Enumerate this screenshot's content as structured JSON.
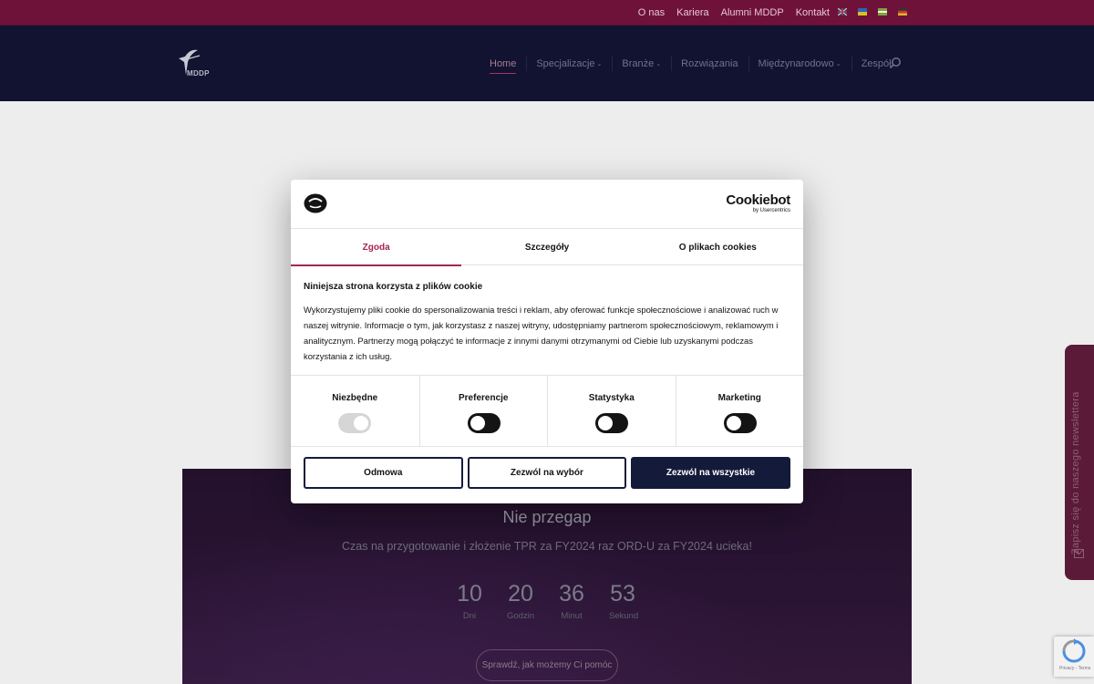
{
  "topbar": {
    "links": [
      "O nas",
      "Kariera",
      "Alumni MDDP",
      "Kontakt"
    ]
  },
  "logo": {
    "text": "MDDP"
  },
  "nav": {
    "items": [
      {
        "label": "Home",
        "active": true,
        "dropdown": false
      },
      {
        "label": "Specjalizacje",
        "active": false,
        "dropdown": true
      },
      {
        "label": "Branże",
        "active": false,
        "dropdown": true
      },
      {
        "label": "Rozwiązania",
        "active": false,
        "dropdown": false
      },
      {
        "label": "Międzynarodowo",
        "active": false,
        "dropdown": true
      },
      {
        "label": "Zespół",
        "active": false,
        "dropdown": false
      }
    ],
    "search_icon": "search-icon"
  },
  "hero": {
    "title": "Nie przegap",
    "subtitle": "Czas na przygotowanie i złożenie TPR za FY2024 raz ORD-U za FY2024 ucieka!",
    "countdown": [
      {
        "value": "10",
        "label": "Dni"
      },
      {
        "value": "20",
        "label": "Godzin"
      },
      {
        "value": "36",
        "label": "Minut"
      },
      {
        "value": "53",
        "label": "Sekund"
      }
    ],
    "cta": "Sprawdź, jak możemy Ci pomóc"
  },
  "newsletter": {
    "label": "Zapisz się do naszego newslettera"
  },
  "recaptcha": {
    "terms": "Privacy - Terms"
  },
  "cookie_dialog": {
    "brand": "Cookiebot",
    "brand_sub": "by Usercentrics",
    "tabs": [
      "Zgoda",
      "Szczegóły",
      "O plikach cookies"
    ],
    "active_tab": "Zgoda",
    "title": "Niniejsza strona korzysta z plików cookie",
    "text": "Wykorzystujemy pliki cookie do spersonalizowania treści i reklam, aby oferować funkcje społecznościowe i analizować ruch w naszej witrynie. Informacje o tym, jak korzystasz z naszej witryny, udostępniamy partnerom społecznościowym, reklamowym i analitycznym. Partnerzy mogą połączyć te informacje z innymi danymi otrzymanymi od Ciebie lub uzyskanymi podczas korzystania z ich usług.",
    "toggles": [
      {
        "label": "Niezbędne",
        "on": true,
        "disabled": true
      },
      {
        "label": "Preferencje",
        "on": false,
        "disabled": false
      },
      {
        "label": "Statystyka",
        "on": false,
        "disabled": false
      },
      {
        "label": "Marketing",
        "on": false,
        "disabled": false
      }
    ],
    "buttons": {
      "deny": "Odmowa",
      "allow_selection": "Zezwól na wybór",
      "allow_all": "Zezwól na wszystkie"
    }
  },
  "colors": {
    "topbar": "#6f1239",
    "header": "#111330",
    "accent": "#a7254f",
    "button_dark": "#141b3a"
  }
}
